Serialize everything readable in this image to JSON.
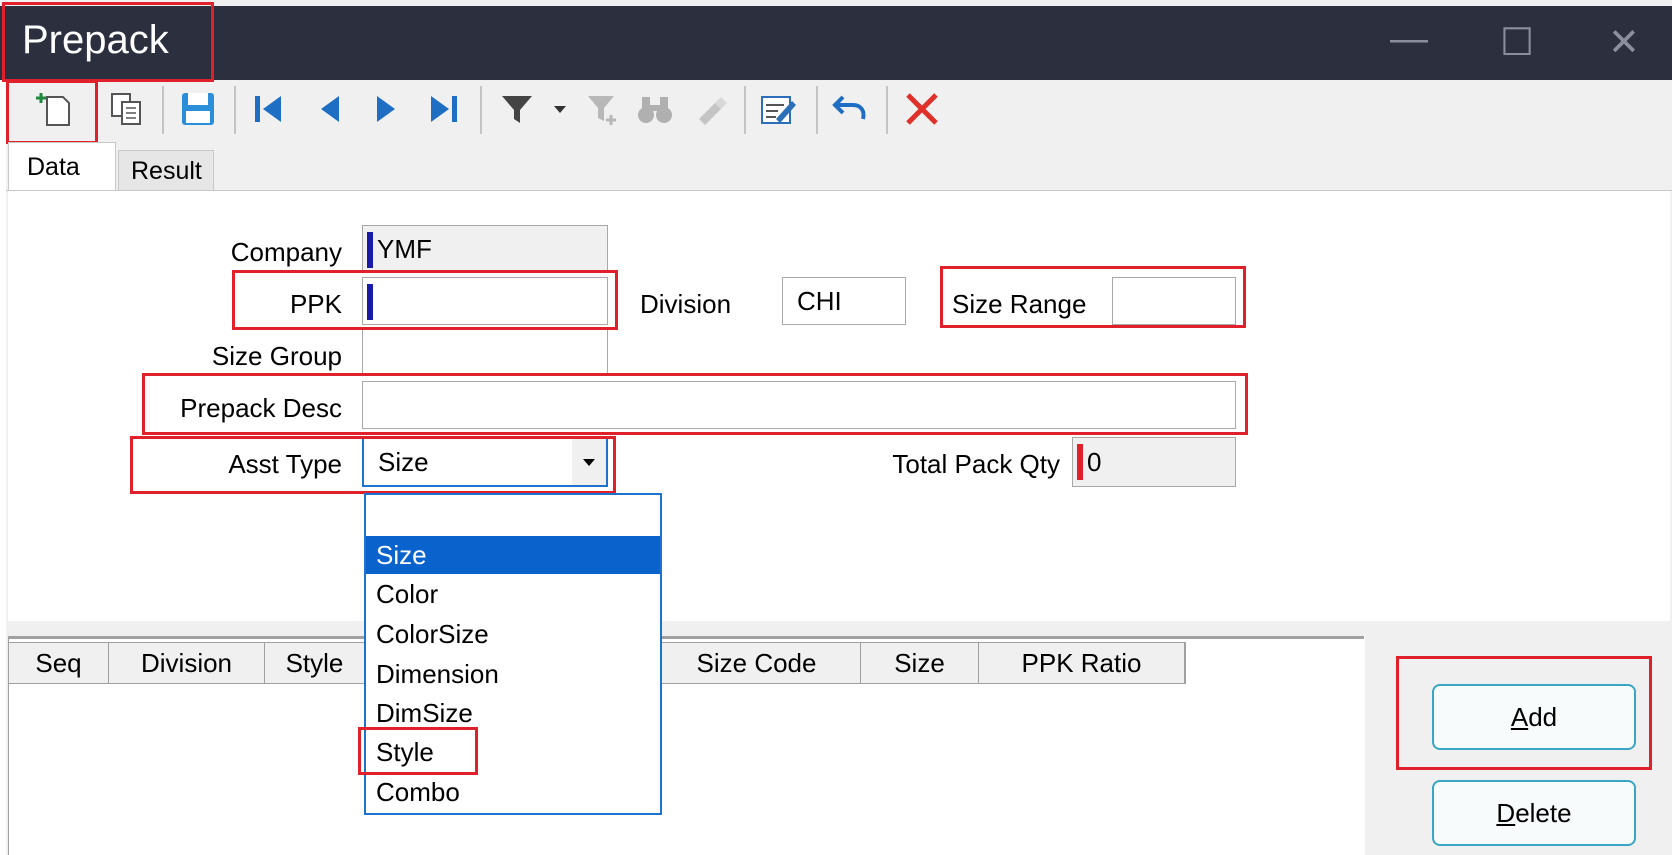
{
  "window": {
    "title": "Prepack",
    "minimize_glyph": "—",
    "maximize_glyph": "☐",
    "close_glyph": "✕"
  },
  "toolbar": {
    "icons": [
      "new-record-icon",
      "copy-icon",
      "save-icon",
      "first-record-icon",
      "previous-record-icon",
      "next-record-icon",
      "last-record-icon",
      "filter-icon",
      "filter-dropdown-icon",
      "clear-filter-icon",
      "find-icon",
      "clear-find-icon",
      "edit-document-icon",
      "undo-icon",
      "delete-icon"
    ]
  },
  "tabs": [
    {
      "label": "Data",
      "active": true
    },
    {
      "label": "Result",
      "active": false
    }
  ],
  "form": {
    "company": {
      "label": "Company",
      "value": "YMF"
    },
    "ppk": {
      "label": "PPK",
      "value": ""
    },
    "division": {
      "label": "Division",
      "value": "CHI"
    },
    "size_range": {
      "label": "Size Range",
      "value": ""
    },
    "size_group": {
      "label": "Size Group",
      "value": ""
    },
    "prepack_desc": {
      "label": "Prepack Desc",
      "value": ""
    },
    "asst_type": {
      "label": "Asst Type",
      "value": "Size"
    },
    "total_pack_qty": {
      "label": "Total Pack Qty",
      "value": "0"
    }
  },
  "dropdown": {
    "options": [
      "",
      "Size",
      "Color",
      "ColorSize",
      "Dimension",
      "DimSize",
      "Style",
      "Combo"
    ],
    "selected": "Size"
  },
  "grid": {
    "columns": [
      "Seq",
      "Division",
      "Style",
      "Size Code",
      "Size",
      "PPK Ratio"
    ]
  },
  "buttons": {
    "add_prefix": "A",
    "add_rest": "dd",
    "delete_prefix": "D",
    "delete_rest": "elete"
  },
  "colors": {
    "titlebar": "#2b2f3e",
    "highlight": "#e0202a",
    "selection": "#0a63cc",
    "button_border": "#3aa6c6"
  }
}
